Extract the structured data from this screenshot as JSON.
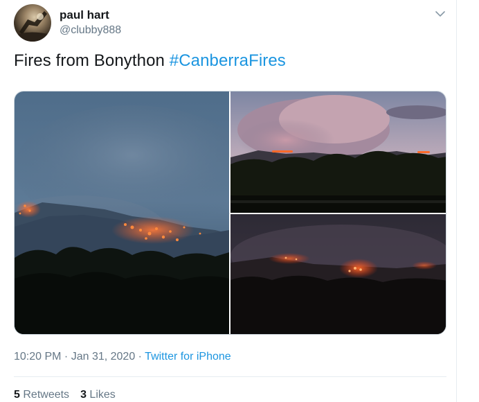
{
  "author": {
    "name": "paul hart",
    "handle": "@clubby888"
  },
  "tweet": {
    "text": "Fires from Bonython",
    "hashtag": "#CanberraFires"
  },
  "meta": {
    "time": "10:20 PM",
    "separator": " · ",
    "date": "Jan 31, 2020",
    "source": "Twitter for iPhone"
  },
  "stats": {
    "retweets_count": "5",
    "retweets_label": "Retweets",
    "likes_count": "3",
    "likes_label": "Likes"
  },
  "colors": {
    "link": "#1b95e0",
    "secondary_text": "#657786",
    "primary_text": "#14171a",
    "border": "#e6ecf0"
  },
  "icons": {
    "more": "chevron-down-icon"
  }
}
